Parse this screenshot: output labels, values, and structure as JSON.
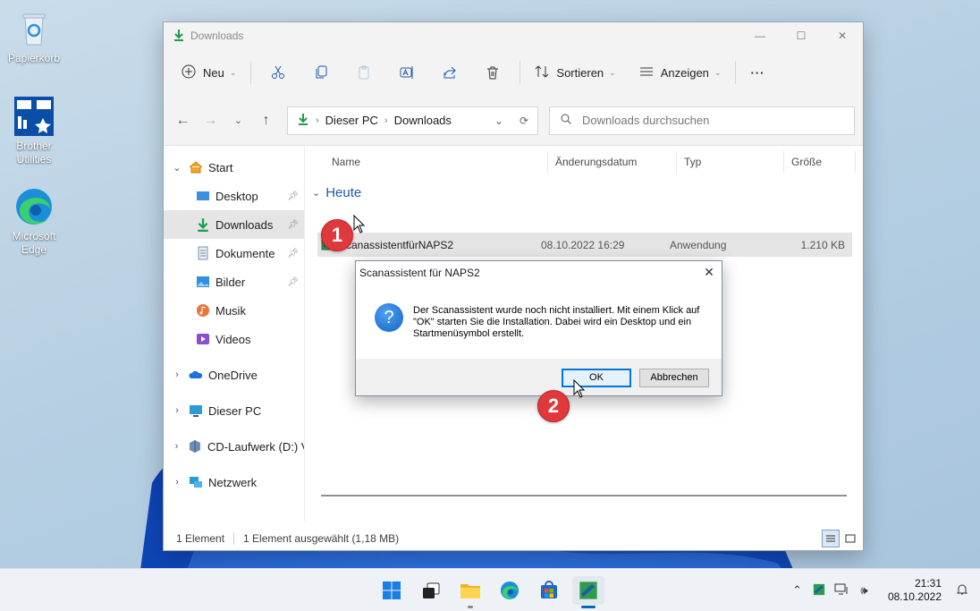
{
  "desktop": {
    "icons": [
      {
        "label": "Papierkorb"
      },
      {
        "label": "Brother Utilities"
      },
      {
        "label": "Microsoft Edge"
      }
    ]
  },
  "explorer": {
    "window_title": "Downloads",
    "commands": {
      "new": "Neu",
      "sort": "Sortieren",
      "view": "Anzeigen",
      "more": "···"
    },
    "address": {
      "segments": [
        "Dieser PC",
        "Downloads"
      ]
    },
    "search": {
      "placeholder": "Downloads durchsuchen"
    },
    "nav": {
      "home": "Start",
      "desktop": "Desktop",
      "downloads": "Downloads",
      "documents": "Dokumente",
      "pictures": "Bilder",
      "music": "Musik",
      "videos": "Videos",
      "onedrive": "OneDrive",
      "thispc": "Dieser PC",
      "cddrive": "CD-Laufwerk (D:) Vi",
      "network": "Netzwerk"
    },
    "columns": [
      "Name",
      "Änderungsdatum",
      "Typ",
      "Größe"
    ],
    "group": "Heute",
    "files": [
      {
        "name": "ScanassistentfürNAPS2",
        "date": "08.10.2022 16:29",
        "type": "Anwendung",
        "size": "1.210 KB"
      }
    ],
    "status": {
      "count": "1 Element",
      "selected": "1 Element ausgewählt (1,18 MB)"
    }
  },
  "dialog": {
    "title": "Scanassistent für NAPS2",
    "message": "Der Scanassistent wurde noch nicht installiert. Mit einem Klick auf \"OK\" starten Sie die Installation. Dabei wird ein Desktop und ein Startmenüsymbol erstellt.",
    "ok": "OK",
    "cancel": "Abbrechen"
  },
  "steps": [
    "1",
    "2"
  ],
  "taskbar": {
    "time": "21:31",
    "date": "08.10.2022"
  },
  "colors": {
    "accent": "#0067c0",
    "badge": "#e0383b",
    "link_group": "#1e5aa8"
  }
}
